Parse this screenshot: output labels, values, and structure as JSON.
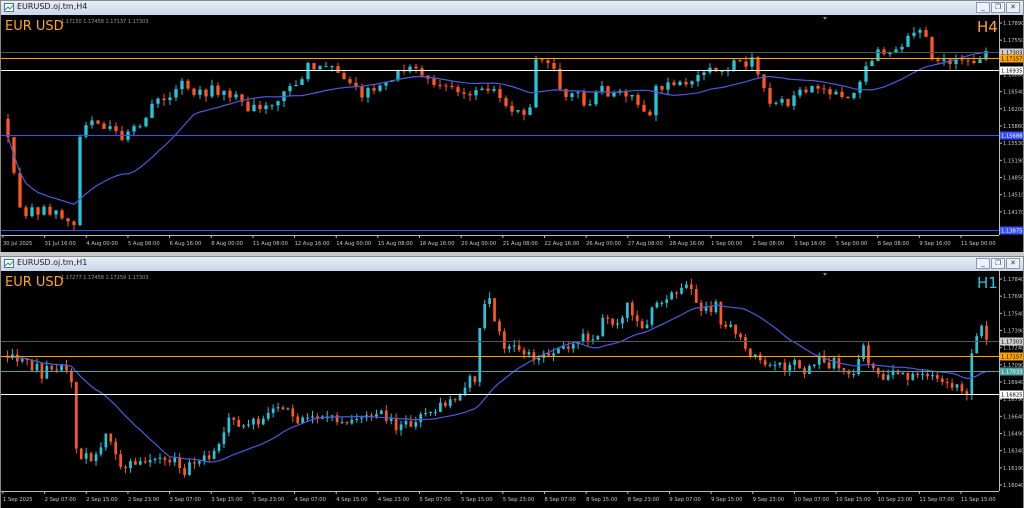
{
  "windows": [
    {
      "title": "EURUSD.oj.tm,H4",
      "buttons": [
        "_",
        "❐",
        "✕"
      ]
    },
    {
      "title": "EURUSD.oj.tm,H1",
      "buttons": [
        "_",
        "❐",
        "✕"
      ]
    }
  ],
  "chart_data": [
    {
      "type": "candlestick",
      "symbol_label": "EUR USD",
      "timeframe_label": "H4",
      "ohlc_header": "1.17150 1.17458 1.17137 1.17303",
      "colors": {
        "background": "#000000",
        "bull": "#26c6da",
        "bear": "#ff5722",
        "symbol": "#ffa726",
        "timeframe": "#ffa726",
        "ma": "#4a5ce0"
      },
      "y_ticks": [
        "1.17890",
        "1.17550",
        "1.17210",
        "1.16880",
        "1.16540",
        "1.16200",
        "1.15860",
        "1.15530",
        "1.15190",
        "1.14850",
        "1.14510",
        "1.14170",
        "1.13840"
      ],
      "ylim": [
        1.1378,
        1.1795
      ],
      "x_ticks": [
        "30 Jul 2025",
        "31 Jul 16:00",
        "4 Aug 00:00",
        "5 Aug 08:00",
        "6 Aug 16:00",
        "8 Aug 00:00",
        "11 Aug 08:00",
        "12 Aug 16:00",
        "14 Aug 00:00",
        "15 Aug 08:00",
        "18 Aug 16:00",
        "20 Aug 00:00",
        "21 Aug 08:00",
        "22 Aug 16:00",
        "26 Aug 00:00",
        "27 Aug 08:00",
        "28 Aug 16:00",
        "1 Sep 00:00",
        "2 Sep 08:00",
        "3 Sep 16:00",
        "5 Sep 00:00",
        "8 Sep 08:00",
        "9 Sep 16:00",
        "11 Sep 00:00"
      ],
      "price_lines": [
        {
          "price": 1.1729,
          "label": "1.17303",
          "color": "#555555",
          "label_bg": "#cfcfcf"
        },
        {
          "price": 1.17157,
          "label": "1.17157",
          "color": "#ffa500",
          "label_bg": "#ffa500"
        },
        {
          "price": 1.16935,
          "label": "1.16935",
          "color": "#ffffff",
          "label_bg": "#ffffff"
        },
        {
          "price": 1.15688,
          "label": "1.15688",
          "color": "#3550ff",
          "label_bg": "#3550ff"
        },
        {
          "price": 1.13875,
          "label": "1.13875",
          "color": "#3550ff",
          "label_bg": "#3550ff"
        }
      ],
      "ma_period": 20,
      "closes": [
        1.1565,
        1.1497,
        1.1431,
        1.1414,
        1.1431,
        1.1417,
        1.1432,
        1.1417,
        1.1425,
        1.141,
        1.1404,
        1.1397,
        1.1566,
        1.1588,
        1.1597,
        1.1591,
        1.1581,
        1.1586,
        1.1577,
        1.156,
        1.1576,
        1.1586,
        1.1586,
        1.1602,
        1.1629,
        1.1639,
        1.1636,
        1.1641,
        1.1657,
        1.1673,
        1.1658,
        1.1646,
        1.1656,
        1.1643,
        1.1664,
        1.1646,
        1.1654,
        1.1641,
        1.1647,
        1.1633,
        1.1615,
        1.1627,
        1.1619,
        1.1626,
        1.1626,
        1.1634,
        1.1653,
        1.1663,
        1.1665,
        1.1676,
        1.1707,
        1.1695,
        1.1701,
        1.1701,
        1.1701,
        1.1688,
        1.1676,
        1.1669,
        1.1663,
        1.1641,
        1.1659,
        1.1654,
        1.1664,
        1.1671,
        1.1674,
        1.1693,
        1.1691,
        1.17,
        1.1697,
        1.1683,
        1.1677,
        1.1665,
        1.1664,
        1.1663,
        1.1661,
        1.1651,
        1.1648,
        1.1645,
        1.1655,
        1.1658,
        1.1654,
        1.1657,
        1.164,
        1.1625,
        1.1614,
        1.1617,
        1.1608,
        1.1622,
        1.1714,
        1.1712,
        1.1707,
        1.1696,
        1.1657,
        1.1642,
        1.1649,
        1.1651,
        1.1626,
        1.1628,
        1.1652,
        1.1663,
        1.1643,
        1.165,
        1.1654,
        1.1643,
        1.1646,
        1.1627,
        1.1614,
        1.1607,
        1.1663,
        1.1656,
        1.167,
        1.1665,
        1.1671,
        1.1666,
        1.1672,
        1.1684,
        1.1689,
        1.1698,
        1.1691,
        1.1692,
        1.1693,
        1.1712,
        1.171,
        1.17,
        1.1718,
        1.1685,
        1.1659,
        1.1629,
        1.1631,
        1.1638,
        1.1625,
        1.1645,
        1.1656,
        1.1651,
        1.1663,
        1.1658,
        1.1657,
        1.1647,
        1.1652,
        1.1642,
        1.164,
        1.165,
        1.1671,
        1.1701,
        1.1711,
        1.1733,
        1.1724,
        1.1727,
        1.1733,
        1.1738,
        1.1759,
        1.1765,
        1.177,
        1.1757,
        1.1714,
        1.1711,
        1.1714,
        1.1705,
        1.1714,
        1.1712,
        1.1711,
        1.1707,
        1.1714,
        1.173
      ]
    },
    {
      "type": "candlestick",
      "symbol_label": "EUR USD",
      "timeframe_label": "H1",
      "ohlc_header": "1.17277 1.17458 1.17259 1.17303",
      "colors": {
        "background": "#000000",
        "bull": "#26c6da",
        "bear": "#ff5722",
        "symbol": "#ffa726",
        "timeframe": "#26c6da",
        "ma": "#4a5ce0"
      },
      "y_ticks": [
        "1.17840",
        "1.17690",
        "1.17540",
        "1.17390",
        "1.17240",
        "1.17090",
        "1.16940",
        "1.16790",
        "1.16640",
        "1.16490",
        "1.16340",
        "1.16190",
        "1.16040"
      ],
      "ylim": [
        1.1598,
        1.1788
      ],
      "x_ticks": [
        "1 Sep 2025",
        "2 Sep 07:00",
        "2 Sep 15:00",
        "2 Sep 23:00",
        "3 Sep 07:00",
        "3 Sep 15:00",
        "3 Sep 23:00",
        "4 Sep 07:00",
        "4 Sep 15:00",
        "4 Sep 23:00",
        "5 Sep 07:00",
        "5 Sep 15:00",
        "5 Sep 23:00",
        "8 Sep 07:00",
        "8 Sep 15:00",
        "8 Sep 23:00",
        "9 Sep 07:00",
        "9 Sep 15:00",
        "9 Sep 23:00",
        "10 Sep 07:00",
        "10 Sep 15:00",
        "10 Sep 23:00",
        "11 Sep 07:00",
        "11 Sep 15:00"
      ],
      "price_lines": [
        {
          "price": 1.1729,
          "label": "1.17303",
          "color": "#555555",
          "label_bg": "#cfcfcf"
        },
        {
          "price": 1.17157,
          "label": "1.17157",
          "color": "#ffa500",
          "label_bg": "#ffa500"
        },
        {
          "price": 1.1703,
          "label": "1.17033",
          "color": "#4aa3a3",
          "label_bg": "#4aa3a3"
        },
        {
          "price": 1.16825,
          "label": "1.16825",
          "color": "#ffffff",
          "label_bg": "#ffffff"
        }
      ],
      "ma_period": 20,
      "closes": [
        1.1714,
        1.1717,
        1.1711,
        1.1713,
        1.1712,
        1.1703,
        1.1709,
        1.1696,
        1.1707,
        1.1704,
        1.1703,
        1.1708,
        1.1703,
        1.1693,
        1.1635,
        1.1626,
        1.1631,
        1.1624,
        1.163,
        1.1636,
        1.1648,
        1.1641,
        1.163,
        1.1619,
        1.1618,
        1.1624,
        1.1621,
        1.1624,
        1.1623,
        1.1625,
        1.1626,
        1.1627,
        1.1625,
        1.1623,
        1.1627,
        1.1618,
        1.1612,
        1.1623,
        1.1622,
        1.1624,
        1.1629,
        1.1626,
        1.1633,
        1.1639,
        1.1649,
        1.1662,
        1.166,
        1.1654,
        1.1655,
        1.1656,
        1.1661,
        1.1656,
        1.1661,
        1.1666,
        1.167,
        1.1671,
        1.1669,
        1.167,
        1.1663,
        1.1657,
        1.1662,
        1.1662,
        1.1663,
        1.1661,
        1.1663,
        1.1663,
        1.1664,
        1.1658,
        1.1658,
        1.1657,
        1.166,
        1.1661,
        1.1662,
        1.1664,
        1.1663,
        1.1665,
        1.1668,
        1.1659,
        1.1661,
        1.1651,
        1.1656,
        1.1659,
        1.1654,
        1.1658,
        1.1665,
        1.1666,
        1.1667,
        1.1667,
        1.1675,
        1.1672,
        1.1678,
        1.1677,
        1.1682,
        1.1688,
        1.1698,
        1.1693,
        1.174,
        1.1761,
        1.1766,
        1.1746,
        1.1737,
        1.1722,
        1.1724,
        1.1725,
        1.1721,
        1.1717,
        1.1719,
        1.1712,
        1.1714,
        1.1718,
        1.1716,
        1.1718,
        1.1722,
        1.1724,
        1.1722,
        1.1726,
        1.1728,
        1.1735,
        1.1729,
        1.173,
        1.1733,
        1.1749,
        1.1748,
        1.1743,
        1.1744,
        1.1749,
        1.1762,
        1.1751,
        1.1746,
        1.174,
        1.1743,
        1.1758,
        1.1762,
        1.1762,
        1.1765,
        1.1771,
        1.177,
        1.1775,
        1.1778,
        1.1774,
        1.1762,
        1.1755,
        1.1759,
        1.1754,
        1.1763,
        1.1743,
        1.1741,
        1.1743,
        1.1735,
        1.1732,
        1.1722,
        1.1715,
        1.1717,
        1.1712,
        1.1708,
        1.1708,
        1.1708,
        1.171,
        1.1703,
        1.1708,
        1.1712,
        1.1705,
        1.17,
        1.1707,
        1.1708,
        1.1716,
        1.171,
        1.1705,
        1.1714,
        1.1705,
        1.1703,
        1.17,
        1.17,
        1.1713,
        1.1725,
        1.1709,
        1.1705,
        1.17,
        1.1695,
        1.1699,
        1.1703,
        1.17,
        1.1701,
        1.1695,
        1.17,
        1.1699,
        1.17,
        1.1698,
        1.1699,
        1.1696,
        1.1693,
        1.1692,
        1.1688,
        1.1691,
        1.1685,
        1.1682,
        1.1718,
        1.1733,
        1.1742,
        1.173
      ]
    }
  ]
}
